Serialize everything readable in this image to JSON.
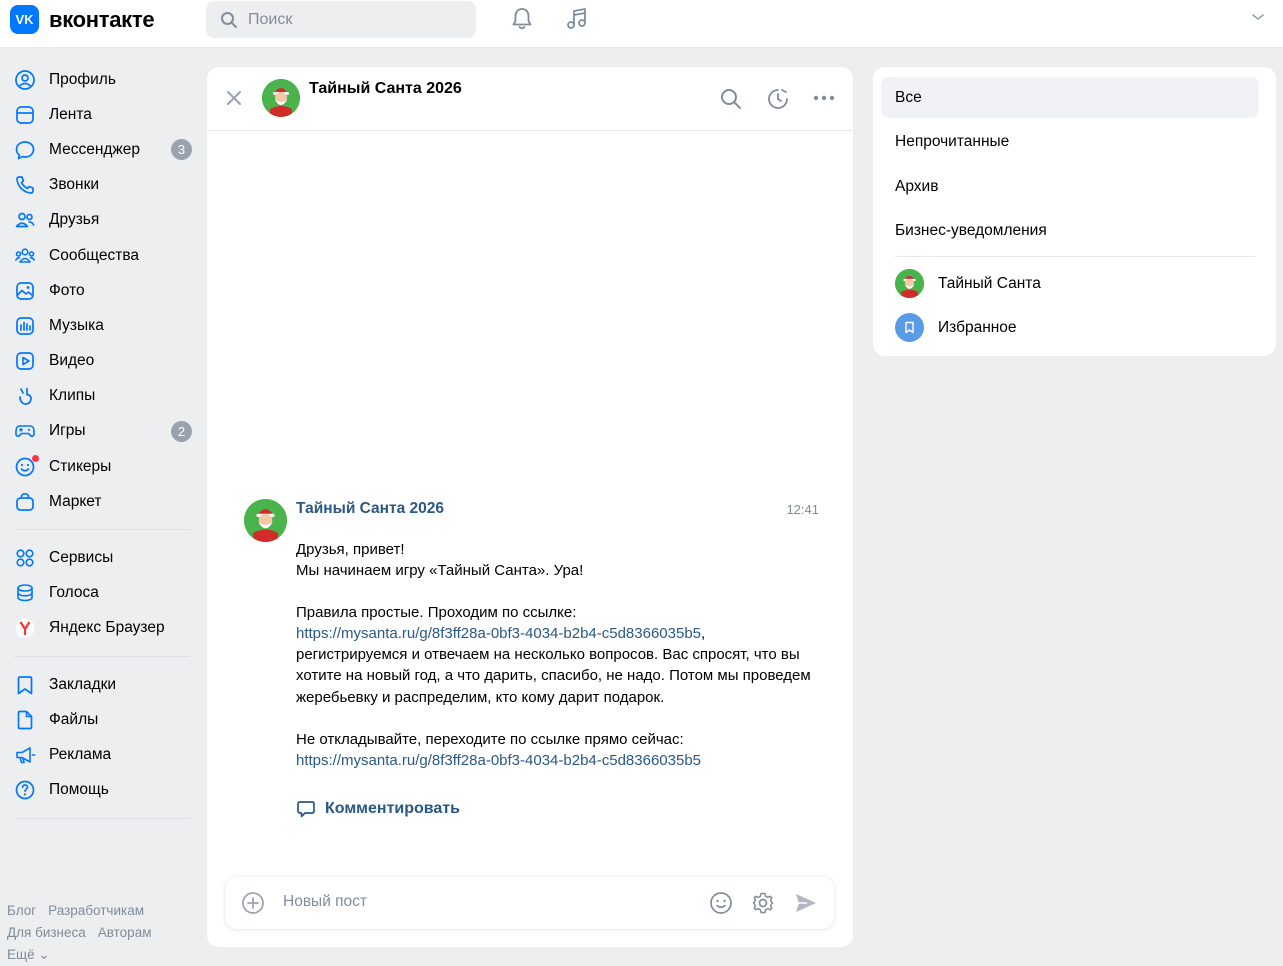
{
  "header": {
    "logo_mark": "VK",
    "logo_text": "вконтакте",
    "search_placeholder": "Поиск"
  },
  "sidebar": {
    "items": [
      {
        "label": "Профиль",
        "icon": "profile-icon"
      },
      {
        "label": "Лента",
        "icon": "feed-icon"
      },
      {
        "label": "Мессенджер",
        "icon": "messenger-icon",
        "badge": "3"
      },
      {
        "label": "Звонки",
        "icon": "phone-icon"
      },
      {
        "label": "Друзья",
        "icon": "friends-icon"
      },
      {
        "label": "Сообщества",
        "icon": "communities-icon"
      },
      {
        "label": "Фото",
        "icon": "photo-icon"
      },
      {
        "label": "Музыка",
        "icon": "music-icon"
      },
      {
        "label": "Видео",
        "icon": "video-icon"
      },
      {
        "label": "Клипы",
        "icon": "clips-icon"
      },
      {
        "label": "Игры",
        "icon": "games-icon",
        "badge": "2"
      },
      {
        "label": "Стикеры",
        "icon": "stickers-icon"
      },
      {
        "label": "Маркет",
        "icon": "market-icon"
      }
    ],
    "items2": [
      {
        "label": "Сервисы",
        "icon": "services-icon"
      },
      {
        "label": "Голоса",
        "icon": "votes-icon"
      },
      {
        "label": "Яндекс Браузер",
        "icon": "yandex-icon"
      }
    ],
    "items3": [
      {
        "label": "Закладки",
        "icon": "bookmark-icon"
      },
      {
        "label": "Файлы",
        "icon": "files-icon"
      },
      {
        "label": "Реклама",
        "icon": "ads-icon"
      },
      {
        "label": "Помощь",
        "icon": "help-icon"
      }
    ],
    "footer": {
      "blog": "Блог",
      "developers": "Разработчикам",
      "business": "Для бизнеса",
      "authors": "Авторам",
      "more": "Ещё ⌄"
    }
  },
  "chat": {
    "title": "Тайный Санта 2026",
    "message": {
      "author": "Тайный Санта 2026",
      "time": "12:41",
      "line1": "Друзья, привет!",
      "line2": "Мы начинаем игру «Тайный Санта». Ура!",
      "rules_intro": "Правила простые. Проходим по ссылке:",
      "link1": "https://mysanta.ru/g/8f3ff28a-0bf3-4034-b2b4-c5d8366035b5",
      "rules_text": "регистрируемся и отвечаем на несколько вопросов. Вас спросят, что вы хотите на новый год, а что дарить, спасибо, не надо. Потом мы проведем жеребьевку и распределим, кто кому дарит подарок.",
      "cta": "Не откладывайте, переходите по ссылке прямо сейчас:",
      "link2": "https://mysanta.ru/g/8f3ff28a-0bf3-4034-b2b4-c5d8366035b5"
    },
    "comment_label": "Комментировать",
    "composer_placeholder": "Новый пост"
  },
  "filters": {
    "all": "Все",
    "unread": "Непрочитанные",
    "archive": "Архив",
    "business": "Бизнес-уведомления",
    "conversations": [
      {
        "label": "Тайный Санта"
      },
      {
        "label": "Избранное"
      }
    ]
  },
  "colors": {
    "accent": "#0077ff",
    "link": "#2a5885",
    "background": "#edeef0",
    "badge": "#99a2ad"
  }
}
